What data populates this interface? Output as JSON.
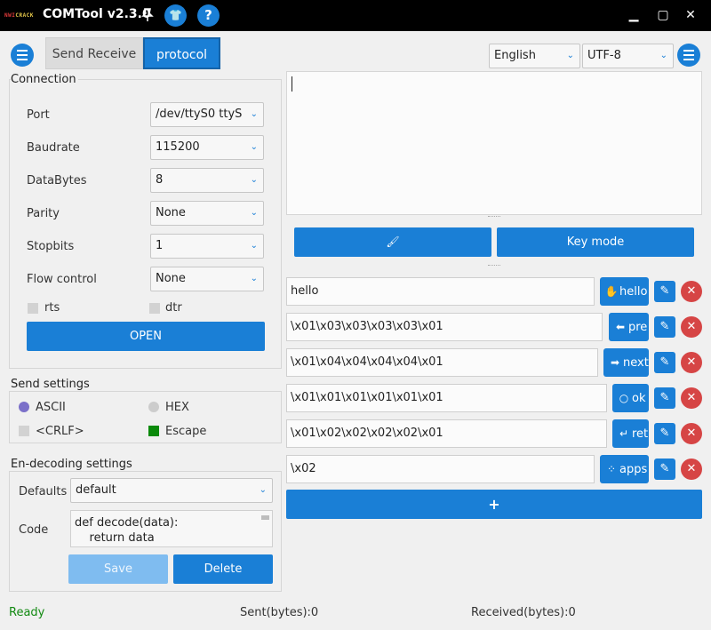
{
  "window": {
    "logo_text": "NWI CRACK",
    "title": "COMTool v2.3.0",
    "skin_glyph": "👕",
    "help_glyph": "?",
    "minimize_glyph": "▁",
    "maximize_glyph": "▢",
    "close_glyph": "✕"
  },
  "tabs": [
    {
      "label": "Send Receive",
      "active": false
    },
    {
      "label": "protocol",
      "active": true
    }
  ],
  "header_combos": {
    "language": "English",
    "encoding": "UTF-8"
  },
  "connection": {
    "title": "Connection",
    "fields": [
      {
        "label": "Port",
        "value": "/dev/ttyS0 ttyS"
      },
      {
        "label": "Baudrate",
        "value": "115200"
      },
      {
        "label": "DataBytes",
        "value": "8"
      },
      {
        "label": "Parity",
        "value": "None"
      },
      {
        "label": "Stopbits",
        "value": "1"
      },
      {
        "label": "Flow control",
        "value": "None"
      }
    ],
    "rts_label": "rts",
    "dtr_label": "dtr",
    "open_label": "OPEN"
  },
  "send_settings": {
    "title": "Send settings",
    "ascii_label": "ASCII",
    "hex_label": "HEX",
    "crlf_label": "<CRLF>",
    "escape_label": "Escape",
    "colors": {
      "ascii": "#7b70c9",
      "hex": "#cccccc",
      "crlf": "#d2d2d2",
      "escape": "#0b8a0b"
    }
  },
  "en_decoding": {
    "title": "En-decoding settings",
    "defaults_label": "Defaults",
    "defaults_value": "default",
    "code_label": "Code",
    "code_line1": "def decode(data):",
    "code_line2": "    return data",
    "save_label": "Save",
    "delete_label": "Delete"
  },
  "receive": {
    "clear_glyph": "🖌",
    "key_mode_label": "Key mode"
  },
  "commands": [
    {
      "value": "hello",
      "button_label": "hello",
      "icon": "hand-icon",
      "glyph": "✋"
    },
    {
      "value": "\\x01\\x03\\x03\\x03\\x03\\x01",
      "button_label": "pre",
      "icon": "arrow-left-icon",
      "glyph": "⬅"
    },
    {
      "value": "\\x01\\x04\\x04\\x04\\x04\\x01",
      "button_label": "next",
      "icon": "arrow-right-icon",
      "glyph": "➡"
    },
    {
      "value": "\\x01\\x01\\x01\\x01\\x01\\x01",
      "button_label": "ok",
      "icon": "circle-icon",
      "glyph": "○"
    },
    {
      "value": "\\x01\\x02\\x02\\x02\\x02\\x01",
      "button_label": "ret",
      "icon": "return-icon",
      "glyph": "↵"
    },
    {
      "value": "\\x02",
      "button_label": "apps",
      "icon": "apps-icon",
      "glyph": "⁘"
    }
  ],
  "edit_glyph": "✎",
  "delete_glyph": "✕",
  "add_glyph": "+",
  "status": {
    "state": "Ready",
    "sent": "Sent(bytes):0",
    "received": "Received(bytes):0",
    "ready_color": "#138a13"
  },
  "colors": {
    "accent": "#1a7fd6",
    "danger": "#d64545",
    "title_bar": "#000000"
  }
}
